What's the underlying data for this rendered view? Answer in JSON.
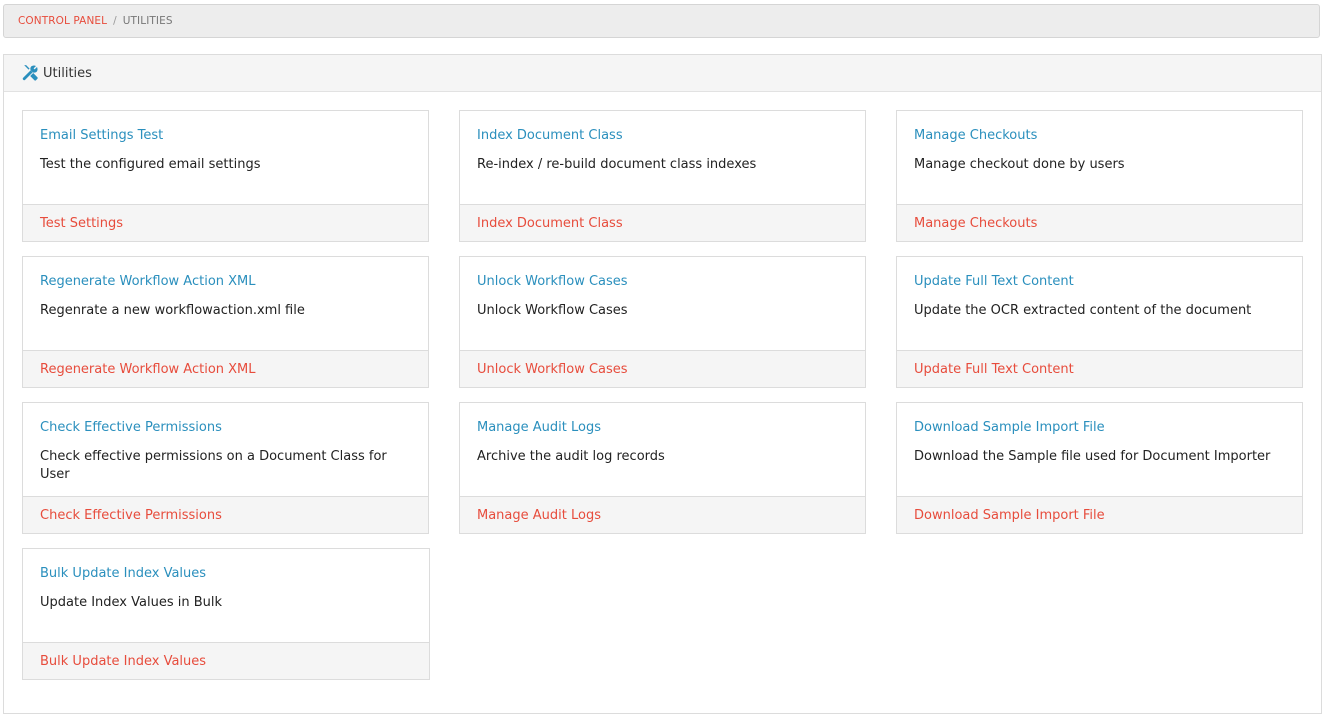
{
  "breadcrumb": {
    "items": [
      "CONTROL PANEL",
      "UTILITIES"
    ],
    "separator": "/"
  },
  "panel": {
    "title": "Utilities",
    "icon": "tools-icon"
  },
  "colors": {
    "link_blue": "#2a8fbd",
    "action_red": "#e74c3c",
    "icon_blue": "#2a8fbd"
  },
  "cards": [
    {
      "title": "Email Settings Test",
      "description": "Test the configured email settings",
      "action": "Test Settings"
    },
    {
      "title": "Index Document Class",
      "description": "Re-index / re-build document class indexes",
      "action": "Index Document Class"
    },
    {
      "title": "Manage Checkouts",
      "description": "Manage checkout done by users",
      "action": "Manage Checkouts"
    },
    {
      "title": "Regenerate Workflow Action XML",
      "description": "Regenrate a new workflowaction.xml file",
      "action": "Regenerate Workflow Action XML"
    },
    {
      "title": "Unlock Workflow Cases",
      "description": "Unlock Workflow Cases",
      "action": "Unlock Workflow Cases"
    },
    {
      "title": "Update Full Text Content",
      "description": "Update the OCR extracted content of the document",
      "action": "Update Full Text Content"
    },
    {
      "title": "Check Effective Permissions",
      "description": "Check effective permissions on a Document Class for User",
      "action": "Check Effective Permissions"
    },
    {
      "title": "Manage Audit Logs",
      "description": "Archive the audit log records",
      "action": "Manage Audit Logs"
    },
    {
      "title": "Download Sample Import File",
      "description": "Download the Sample file used for Document Importer",
      "action": "Download Sample Import File"
    },
    {
      "title": "Bulk Update Index Values",
      "description": "Update Index Values in Bulk",
      "action": "Bulk Update Index Values"
    }
  ]
}
